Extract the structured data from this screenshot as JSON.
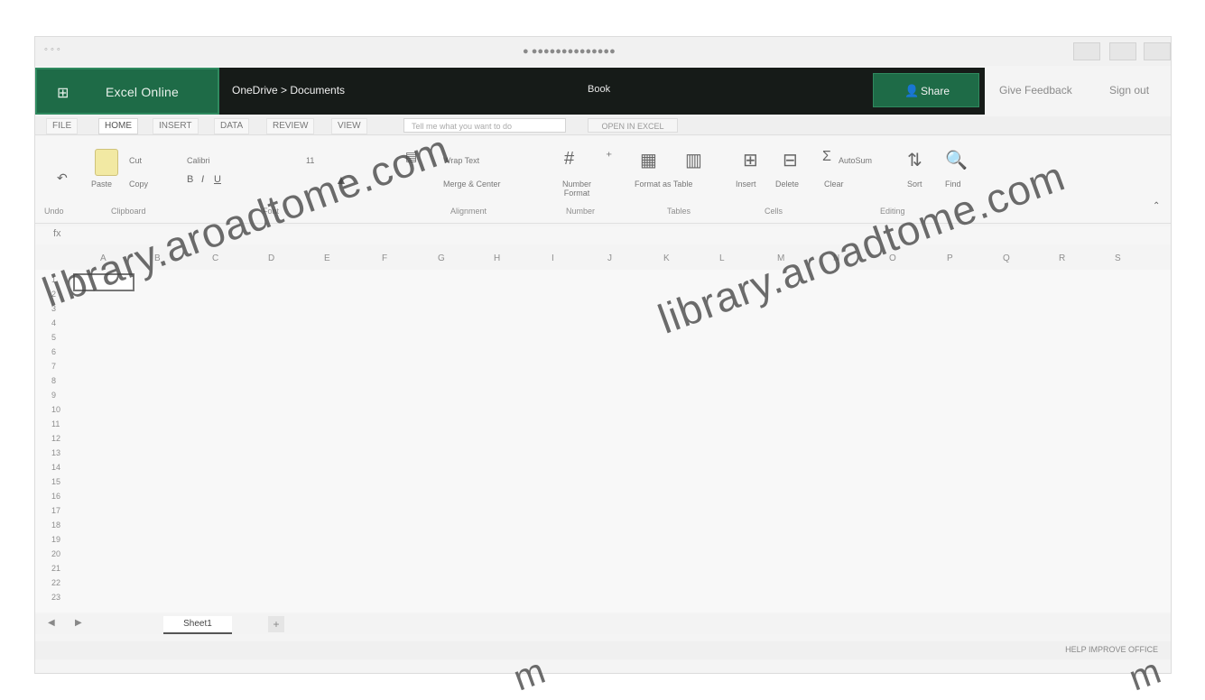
{
  "watermark": {
    "text": "library.aroadtome.com",
    "fragment_bottom_left": "m",
    "fragment_bottom_right": "m"
  },
  "topbar": {
    "app_name": "Excel Online",
    "breadcrumb": "OneDrive > Documents",
    "book_name": "Book",
    "share_label": "Share",
    "sign_out": "Give Feedback",
    "sign_in": "Sign out"
  },
  "tabs": [
    {
      "label": "FILE"
    },
    {
      "label": "HOME"
    },
    {
      "label": "INSERT"
    },
    {
      "label": "DATA"
    },
    {
      "label": "REVIEW"
    },
    {
      "label": "VIEW"
    }
  ],
  "tell_me_placeholder": "Tell me what you want to do",
  "open_desktop": "OPEN IN EXCEL",
  "ribbon": {
    "paste": "Paste",
    "cut": "Cut",
    "copy": "Copy",
    "font": "Calibri",
    "size": "11",
    "wrap": "Wrap Text",
    "merge": "Merge & Center",
    "number_format": "Number Format",
    "format_as_table": "Format as Table",
    "insert": "Insert",
    "delete": "Delete",
    "autosum": "AutoSum",
    "clear": "Clear",
    "sort": "Sort",
    "find": "Find",
    "groups": {
      "undo": "Undo",
      "clipboard": "Clipboard",
      "font": "Font",
      "alignment": "Alignment",
      "number": "Number",
      "tables": "Tables",
      "cells": "Cells",
      "editing": "Editing"
    }
  },
  "formula": {
    "fx": "fx"
  },
  "columns": [
    "A",
    "B",
    "C",
    "D",
    "E",
    "F",
    "G",
    "H",
    "I",
    "J",
    "K",
    "L",
    "M",
    "N",
    "O",
    "P",
    "Q",
    "R",
    "S"
  ],
  "rows": [
    "1",
    "2",
    "3",
    "4",
    "5",
    "6",
    "7",
    "8",
    "9",
    "10",
    "11",
    "12",
    "13",
    "14",
    "15",
    "16",
    "17",
    "18",
    "19",
    "20",
    "21",
    "22",
    "23"
  ],
  "sheet": {
    "tab_label": "Sheet1",
    "add_icon": "+",
    "nav_prev": "◀",
    "nav_next": "▶"
  },
  "status": {
    "text": "HELP IMPROVE OFFICE"
  },
  "colors": {
    "accent": "#1e6b47",
    "topbar": "#161b18"
  }
}
